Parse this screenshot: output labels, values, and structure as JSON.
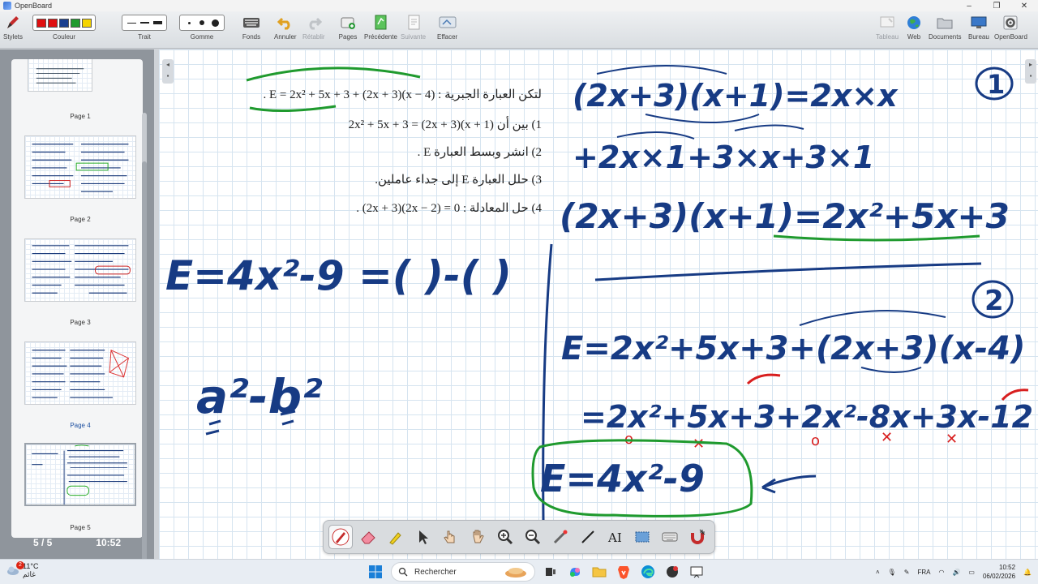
{
  "window": {
    "title": "OpenBoard"
  },
  "toolbar": {
    "stylets": "Stylets",
    "couleur": "Couleur",
    "trait": "Trait",
    "gomme": "Gomme",
    "fonds": "Fonds",
    "annuler": "Annuler",
    "retablir": "Rétablir",
    "pages": "Pages",
    "precedente": "Précédente",
    "suivante": "Suivante",
    "effacer": "Effacer",
    "tableau": "Tableau",
    "web": "Web",
    "documents": "Documents",
    "bureau": "Bureau",
    "openboard": "OpenBoard",
    "colors": [
      "#e01010",
      "#e01010",
      "#1a3f8f",
      "#1f9a2e",
      "#f5d400"
    ]
  },
  "sidebar": {
    "pages": [
      {
        "label": "Page 1"
      },
      {
        "label": "Page 2"
      },
      {
        "label": "Page 3"
      },
      {
        "label": "Page 4"
      },
      {
        "label": "Page 5"
      }
    ],
    "page_counter": "5 / 5",
    "time": "10:52"
  },
  "exercise": {
    "main": "لتكن العبارة الجبرية : E = 2x² + 5x + 3 + (2x + 3)(x − 4) .",
    "q1": "1) بين أن 2x² + 5x + 3 = (2x + 3)(x + 1)",
    "q2": "2) انشر وبسط العبارة E .",
    "q3": "3) حلل العبارة E إلى جداء عاملين.",
    "q4": "4) حل المعادلة : 0 = (2x − 2)(2x + 3) ."
  },
  "handwriting": {
    "left_eq": "E=4x²-9 =(     )-(     )",
    "left_identity": "a²-b²",
    "q1_marker": "1",
    "q1_line1": "(2x+3)(x+1)=2x×x",
    "q1_line2": "+2x×1+3×x+3×1",
    "q1_line3": "(2x+3)(x+1)=2x²+5x+3",
    "q2_marker": "2",
    "q2_line1": "E=2x²+5x+3+(2x+3)(x-4)",
    "q2_line2": "=2x²+5x+3+2x²-8x+3x-12",
    "q2_result": "E=4x²-9"
  },
  "taskbar": {
    "weather_temp": "11°C",
    "weather_text": "غائم",
    "weather_badge": "2",
    "search_placeholder": "Rechercher",
    "language": "FRA",
    "clock_time": "10:52",
    "clock_date": "06/02/2026"
  }
}
